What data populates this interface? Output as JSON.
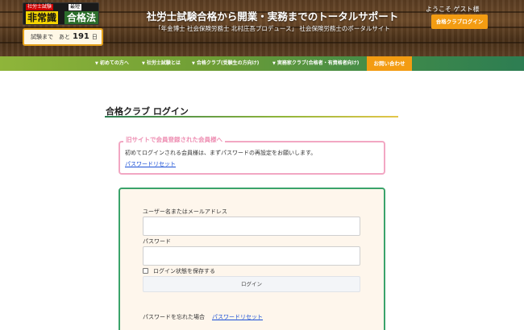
{
  "header": {
    "logo": {
      "small_left": "社労士試験",
      "small_right": "最短",
      "big_left": "非常識",
      "big_right": "合格法"
    },
    "countdown": {
      "prefix": "試験まで　あと",
      "days": "191",
      "suffix": "日"
    },
    "title": "社労士試験合格から開業・実務までのトータルサポート",
    "subtitle": "「年金博士 社会保険労務士 北村庄吾プロデュース」 社会保険労務士のポータルサイト",
    "welcome": "ようこそ ゲスト様",
    "member_login_label": "合格クラブログイン"
  },
  "nav": {
    "items": [
      "初めての方へ",
      "社労士試験とは",
      "合格クラブ(受験生の方向け)",
      "実務家クラブ(合格者・有資格者向け)"
    ],
    "contact_label": "お問い合わせ"
  },
  "main": {
    "title": "合格クラブ ログイン",
    "old_site": {
      "title": "旧サイトで会員登録された会員様へ",
      "text": "初めてログインされる会員様は、まずパスワードの再設定をお願いします。",
      "link": "パスワードリセット"
    },
    "login": {
      "username_label": "ユーザー名またはメールアドレス",
      "username_value": "",
      "password_label": "パスワード",
      "password_value": "",
      "remember_label": "ログイン状態を保存する",
      "remember_checked": false,
      "submit_label": "ログイン",
      "forgot_text": "パスワードを忘れた場合",
      "forgot_link": "パスワードリセット"
    }
  },
  "colors": {
    "accent_orange": "#f39c12",
    "nav_green": "#6f9e35",
    "login_border": "#3aa36a",
    "notice_border": "#f2a7c3",
    "link": "#1a4fd6"
  }
}
